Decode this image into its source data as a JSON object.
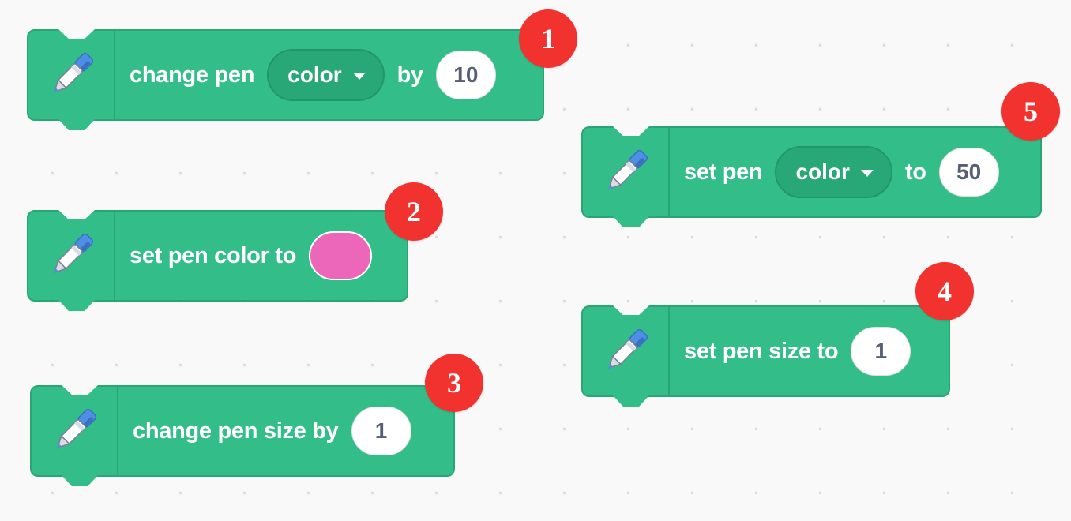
{
  "blocks": {
    "change_color": {
      "label_1": "change pen",
      "dropdown": "color",
      "label_2": "by",
      "value": "10",
      "badge": "1"
    },
    "set_color_to": {
      "label": "set pen color to",
      "swatch_color": "#ec66b9",
      "badge": "2"
    },
    "change_size": {
      "label": "change pen size by",
      "value": "1",
      "badge": "3"
    },
    "set_size": {
      "label": "set pen size to",
      "value": "1",
      "badge": "4"
    },
    "set_param": {
      "label_1": "set pen",
      "dropdown": "color",
      "label_2": "to",
      "value": "50",
      "badge": "5"
    }
  },
  "colors": {
    "block_green": "#33be89",
    "dropdown_green": "#29a877",
    "badge_red": "#f1322f",
    "canvas_bg": "#f9f9f9"
  },
  "icons": {
    "block_icon": "pen-icon",
    "dropdown_icon": "caret-down-icon"
  }
}
